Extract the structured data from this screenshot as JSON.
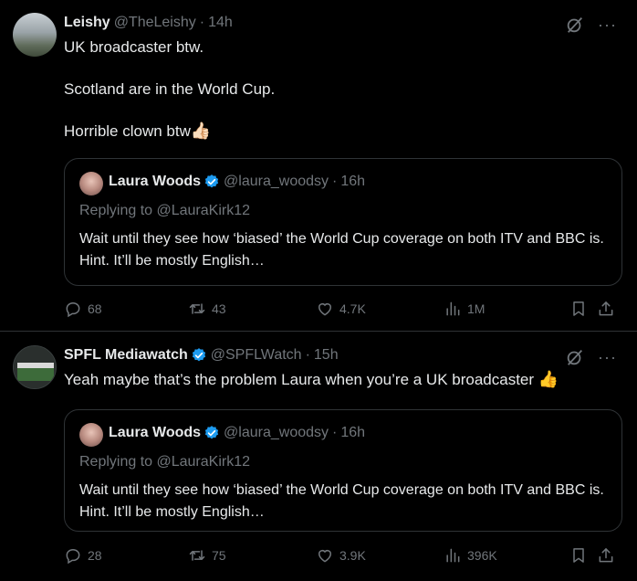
{
  "colors": {
    "background": "#000000",
    "text": "#e7e9ea",
    "muted": "#71767b",
    "border": "#2f3336",
    "verified": "#1d9bf0"
  },
  "tweets": [
    {
      "author_name": "Leishy",
      "handle": "@TheLeishy",
      "dot": "·",
      "time": "14h",
      "text_lines": [
        "UK broadcaster btw.",
        "",
        "Scotland are in the World Cup.",
        "",
        "Horrible clown btw"
      ],
      "emoji": "👍🏻",
      "quote": {
        "author_name": "Laura Woods",
        "handle": "@laura_woodsy",
        "dot": "·",
        "time": "16h",
        "replying_to": "Replying to @LauraKirk12",
        "text": "Wait until they see how ‘biased’ the World Cup coverage on both ITV and BBC is. Hint. It’ll be mostly English…"
      },
      "stats": {
        "replies": "68",
        "retweets": "43",
        "likes": "4.7K",
        "views": "1M"
      },
      "more_label": "···"
    },
    {
      "author_name": "SPFL Mediawatch",
      "handle": "@SPFLWatch",
      "dot": "·",
      "time": "15h",
      "text": "Yeah maybe that’s the problem Laura when you’re a UK broadcaster",
      "emoji": "👍",
      "quote": {
        "author_name": "Laura Woods",
        "handle": "@laura_woodsy",
        "dot": "·",
        "time": "16h",
        "replying_to": "Replying to @LauraKirk12",
        "text": "Wait until they see how ‘biased’ the World Cup coverage on both ITV and BBC is. Hint. It’ll be mostly English…"
      },
      "stats": {
        "replies": "28",
        "retweets": "75",
        "likes": "3.9K",
        "views": "396K"
      },
      "more_label": "···"
    }
  ],
  "icons": [
    "grok-icon",
    "more-icon",
    "verified-icon",
    "reply-icon",
    "retweet-icon",
    "like-icon",
    "views-icon",
    "bookmark-icon",
    "share-icon"
  ]
}
